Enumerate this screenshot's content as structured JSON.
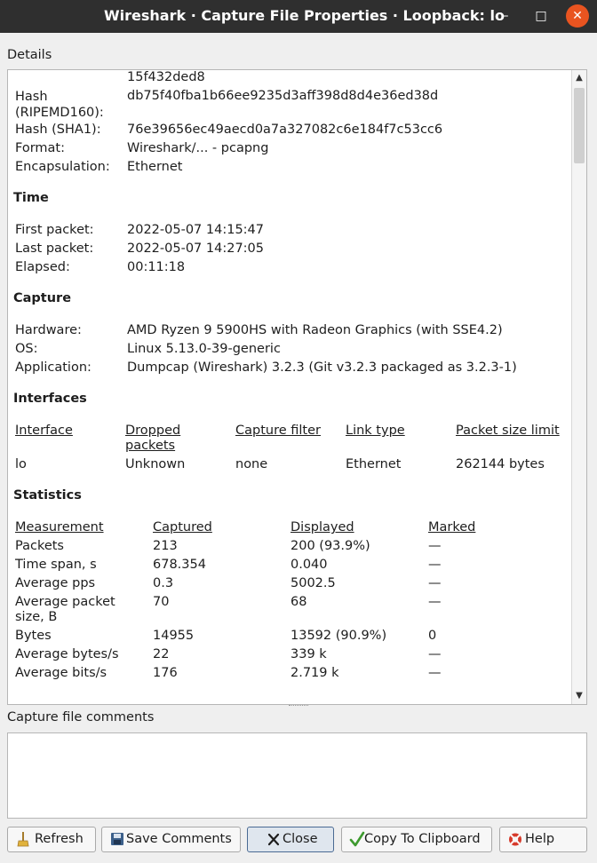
{
  "window": {
    "title": "Wireshark · Capture File Properties · Loopback: lo",
    "minimize_glyph": "–",
    "maximize_glyph": "□",
    "close_glyph": "✕"
  },
  "details_label": "Details",
  "details": {
    "hash_tail": "15f432ded8",
    "file": [
      {
        "label": "Hash\n(RIPEMD160):",
        "value": "db75f40fba1b66ee9235d3aff398d8d4e36ed38d"
      },
      {
        "label": "Hash (SHA1):",
        "value": "76e39656ec49aecd0a7a327082c6e184f7c53cc6"
      },
      {
        "label": "Format:",
        "value": "Wireshark/... - pcapng"
      },
      {
        "label": "Encapsulation:",
        "value": "Ethernet"
      }
    ],
    "time": {
      "heading": "Time",
      "rows": [
        {
          "label": "First packet:",
          "value": "2022-05-07 14:15:47"
        },
        {
          "label": "Last packet:",
          "value": "2022-05-07 14:27:05"
        },
        {
          "label": "Elapsed:",
          "value": "00:11:18"
        }
      ]
    },
    "capture": {
      "heading": "Capture",
      "rows": [
        {
          "label": "Hardware:",
          "value": "AMD Ryzen 9 5900HS with Radeon Graphics (with SSE4.2)"
        },
        {
          "label": "OS:",
          "value": "Linux 5.13.0-39-generic"
        },
        {
          "label": "Application:",
          "value": "Dumpcap (Wireshark) 3.2.3 (Git v3.2.3 packaged as 3.2.3-1)"
        }
      ]
    },
    "interfaces": {
      "heading": "Interfaces",
      "columns": [
        "Interface",
        "Dropped\npackets",
        "Capture filter",
        "Link type",
        "Packet size limit"
      ],
      "rows": [
        [
          "lo",
          "Unknown",
          "none",
          "Ethernet",
          "262144 bytes"
        ]
      ]
    },
    "statistics": {
      "heading": "Statistics",
      "columns": [
        "Measurement",
        "Captured",
        "Displayed",
        "Marked"
      ],
      "rows": [
        [
          "Packets",
          "213",
          "200 (93.9%)",
          "—"
        ],
        [
          "Time span, s",
          "678.354",
          "0.040",
          "—"
        ],
        [
          "Average pps",
          "0.3",
          "5002.5",
          "—"
        ],
        [
          "Average packet\nsize, B",
          "70",
          "68",
          "—"
        ],
        [
          "Bytes",
          "14955",
          "13592 (90.9%)",
          "0"
        ],
        [
          "Average bytes/s",
          "22",
          "339 k",
          "—"
        ],
        [
          "Average bits/s",
          "176",
          "2.719 k",
          "—"
        ]
      ]
    }
  },
  "comments_label": "Capture file comments",
  "comments_value": "",
  "buttons": {
    "refresh": "Refresh",
    "save_comments": "Save Comments",
    "close": "Close",
    "copy": "Copy To Clipboard",
    "help": "Help"
  },
  "colors": {
    "titlebar": "#2f2f2f",
    "close_accent": "#e95420",
    "default_button_border": "#4a6a93"
  }
}
